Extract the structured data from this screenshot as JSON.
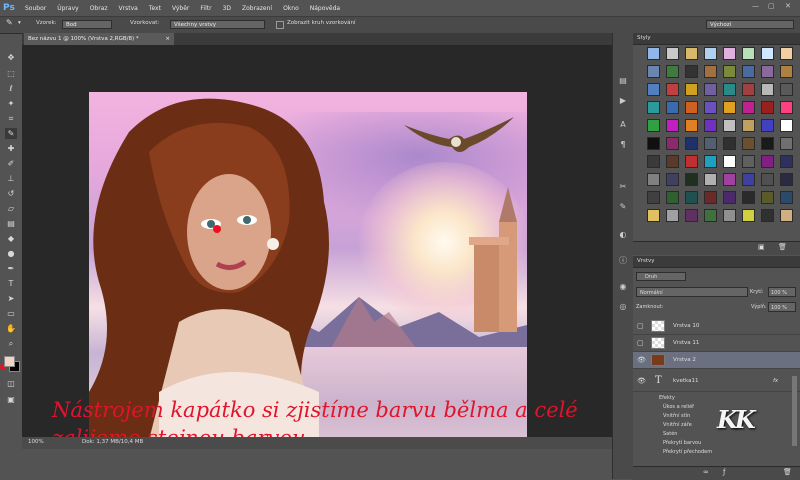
{
  "menubar": {
    "logo": "Ps",
    "items": [
      "Soubor",
      "Úpravy",
      "Obraz",
      "Vrstva",
      "Text",
      "Výběr",
      "Filtr",
      "3D",
      "Zobrazení",
      "Okno",
      "Nápověda"
    ]
  },
  "options": {
    "sample_label": "Vzorek:",
    "sample_value": "Bod",
    "sampling_label": "Vzorkovat:",
    "sampling_value": "Všechny vrstvy",
    "show_ring_label": "Zobrazit kruh vzorkování",
    "workspace_value": "Výchozí"
  },
  "document": {
    "tab_label": "Bez názvu 1 @ 100% (Vrstva 2,RGB/8) *",
    "tab_close": "×"
  },
  "status": {
    "zoom": "100%",
    "doc_info": "Dok: 1,37 MB/10,4 MB"
  },
  "overlay": {
    "line1": "Nástrojem kapátko si zjistíme  barvu bělma a celé",
    "line2": "zalijeme stejnou barvou"
  },
  "styles_panel": {
    "title": "Styly",
    "swatches": [
      "#8fb8e8",
      "#c9c9c9",
      "#d9b86a",
      "#b0d0f0",
      "#e0b0e0",
      "#b8e0b8",
      "#cfe7ff",
      "#f0d0a0",
      "#6a86b0",
      "#3f7a3f",
      "#333333",
      "#a07040",
      "#7a8a3a",
      "#4a6aa0",
      "#8a6a9a",
      "#b08040",
      "#5080c0",
      "#c04040",
      "#d0a020",
      "#7060a0",
      "#2a8a8a",
      "#a04040",
      "#b8b8b8",
      "#5a5a5a",
      "#2a9a9a",
      "#3a6ab0",
      "#d06020",
      "#6a50c0",
      "#e0a020",
      "#c02090",
      "#9a2020",
      "#ff4080",
      "#30a040",
      "#c020c0",
      "#e08020",
      "#7030c0",
      "#c0c0c0",
      "#c0a060",
      "#4040c0",
      "#ffffff",
      "#101010",
      "#8a2a6a",
      "#20306a",
      "#506070",
      "#303030",
      "#6a5030",
      "#1a1a1a",
      "#707070",
      "#3a3a3a",
      "#5a3a2a",
      "#c03030",
      "#20a0c0",
      "#ffffff",
      "#606060",
      "#802080",
      "#303060",
      "#808080",
      "#404060",
      "#203020",
      "#b0b0b0",
      "#a040a0",
      "#4040a0",
      "#505050",
      "#2a2a40",
      "#404040",
      "#306030",
      "#205050",
      "#6a2a2a",
      "#4a2a6a",
      "#2a2a2a",
      "#5a5a2a",
      "#2a4a6a",
      "#e0c060",
      "#a0a0a0",
      "#603060",
      "#407040",
      "#909090",
      "#d0d040",
      "#303030",
      "#d0b080"
    ]
  },
  "layers_panel": {
    "title": "Vrstvy",
    "filter_label": "Druh",
    "blend_mode": "Normální",
    "opacity_label": "Krytí:",
    "opacity_value": "100 %",
    "lock_label": "Zamknout:",
    "fill_label": "Výplň:",
    "fill_value": "100 %",
    "layers": [
      {
        "name": "Vrstva 10",
        "visible": false,
        "selected": false
      },
      {
        "name": "Vrstva 11",
        "visible": false,
        "selected": false
      },
      {
        "name": "Vrstva 2",
        "visible": true,
        "selected": true
      },
      {
        "name": "kvetka11",
        "visible": true,
        "selected": false
      }
    ],
    "fx": "fx",
    "effects_header": "Efekty",
    "effects": [
      "Úkos a reliéf",
      "Vnitřní stín",
      "Vnitřní záře",
      "Satén",
      "Překrytí barvou",
      "Překrytí přechodem"
    ]
  },
  "watermark": "KK",
  "colors": {
    "accent_red": "#e0142c",
    "foreground": "#f0d4c8",
    "background": "#000000"
  }
}
